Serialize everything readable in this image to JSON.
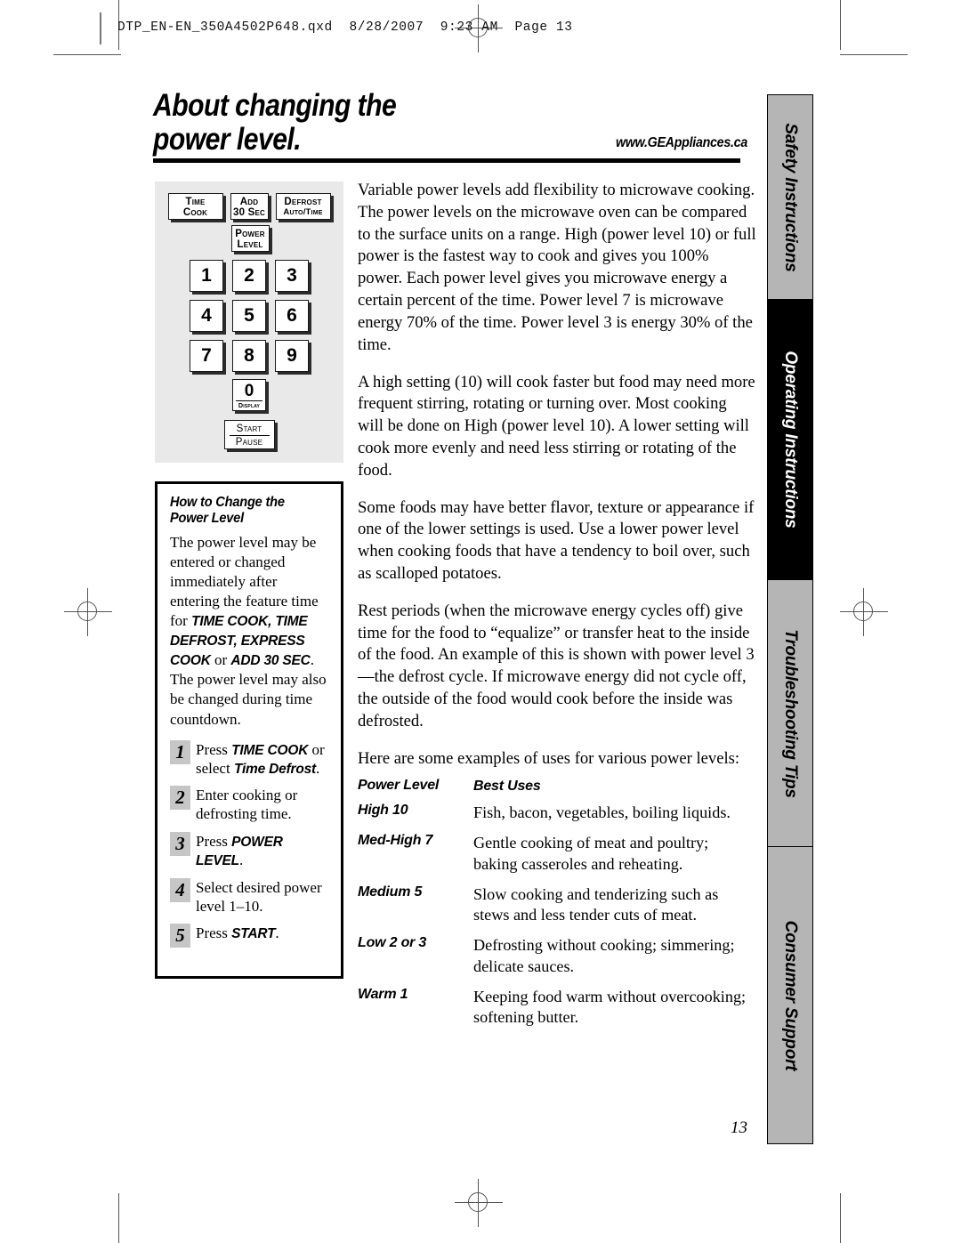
{
  "file_header": "DTP_EN-EN_350A4502P648.qxd  8/28/2007  9:23 AM  Page 13",
  "title": "About changing the\npower level.",
  "site_url": "www.GEAppliances.ca",
  "page_number": "13",
  "keypad": {
    "time_cook": "Time\nCook",
    "time_cook_line1": "Time",
    "time_cook_line2": "Cook",
    "add30_line1": "Add",
    "add30_line2": "30 Sec",
    "defrost_line1": "Defrost",
    "defrost_line2": "Auto/Time",
    "power_level_line1": "Power",
    "power_level_line2": "Level",
    "num_1": "1",
    "num_2": "2",
    "num_3": "3",
    "num_4": "4",
    "num_5": "5",
    "num_6": "6",
    "num_7": "7",
    "num_8": "8",
    "num_9": "9",
    "num_0": "0",
    "zero_sub": "Display",
    "start_line1": "Start",
    "start_line2": "Pause"
  },
  "how_box": {
    "heading": "How to Change the\nPower Level",
    "para1_part1": "The power level may be entered or changed immediately after entering the feature time for ",
    "para1_bold1": "TIME COOK, TIME DEFROST, EXPRESS COOK",
    "para1_mid": " or ",
    "para1_bold2": "ADD 30 SEC",
    "para1_end": ".",
    "para2": "The power level may also be changed during time countdown.",
    "steps": [
      {
        "number": "1",
        "text_part1": "Press ",
        "bold1": "TIME COOK",
        "text_part2": " or select ",
        "bold2": "Time Defrost",
        "text_part3": "."
      },
      {
        "number": "2",
        "text_part1": "Enter cooking or defrosting time.",
        "bold1": "",
        "text_part2": "",
        "bold2": "",
        "text_part3": ""
      },
      {
        "number": "3",
        "text_part1": "Press ",
        "bold1": "POWER LEVEL",
        "text_part2": ".",
        "bold2": "",
        "text_part3": ""
      },
      {
        "number": "4",
        "text_part1": "Select desired power level 1–10.",
        "bold1": "",
        "text_part2": "",
        "bold2": "",
        "text_part3": ""
      },
      {
        "number": "5",
        "text_part1": "Press ",
        "bold1": "START",
        "text_part2": ".",
        "bold2": "",
        "text_part3": ""
      }
    ]
  },
  "main": {
    "paragraphs": [
      "Variable power levels add flexibility to microwave cooking. The power levels on the microwave oven can be compared to the surface units on a range. High (power level 10) or full power is the fastest way to cook and gives you 100% power. Each power level gives you microwave energy a certain percent of the time. Power level 7 is microwave energy 70% of the time. Power level 3 is energy 30% of the time.",
      "A high setting (10) will cook faster but food may need more frequent stirring, rotating or turning over. Most cooking will be done on High (power level 10). A lower setting will cook more evenly and need less stirring or rotating of the food.",
      "Some foods may have better flavor, texture or appearance if one of the lower settings is used. Use a lower power level when cooking foods that have a tendency to boil over, such as scalloped potatoes.",
      "Rest periods (when the microwave energy cycles off) give time for the food to “equalize” or transfer heat to the inside of the food. An example of this is shown with power level 3—the defrost cycle. If microwave energy did not cycle off, the outside of the food would cook before the inside was defrosted.",
      "Here are some examples of uses for various power levels:"
    ],
    "uses_table": {
      "header": {
        "level": "Power Level",
        "uses": "Best Uses"
      },
      "rows": [
        {
          "level": "High 10",
          "uses": "Fish, bacon, vegetables, boiling liquids."
        },
        {
          "level": "Med-High 7",
          "uses": "Gentle cooking of meat and poultry; baking casseroles and reheating."
        },
        {
          "level": "Medium 5",
          "uses": "Slow cooking and tenderizing such as stews and less tender cuts of meat."
        },
        {
          "level": "Low 2 or 3",
          "uses": "Defrosting without cooking; simmering; delicate sauces."
        },
        {
          "level": "Warm 1",
          "uses": "Keeping food warm without overcooking; softening butter."
        }
      ]
    }
  },
  "side_tabs": [
    {
      "label": "Safety Instructions",
      "active": false
    },
    {
      "label": "Operating Instructions",
      "active": true
    },
    {
      "label": "Troubleshooting Tips",
      "active": false
    },
    {
      "label": "Consumer Support",
      "active": false
    }
  ]
}
